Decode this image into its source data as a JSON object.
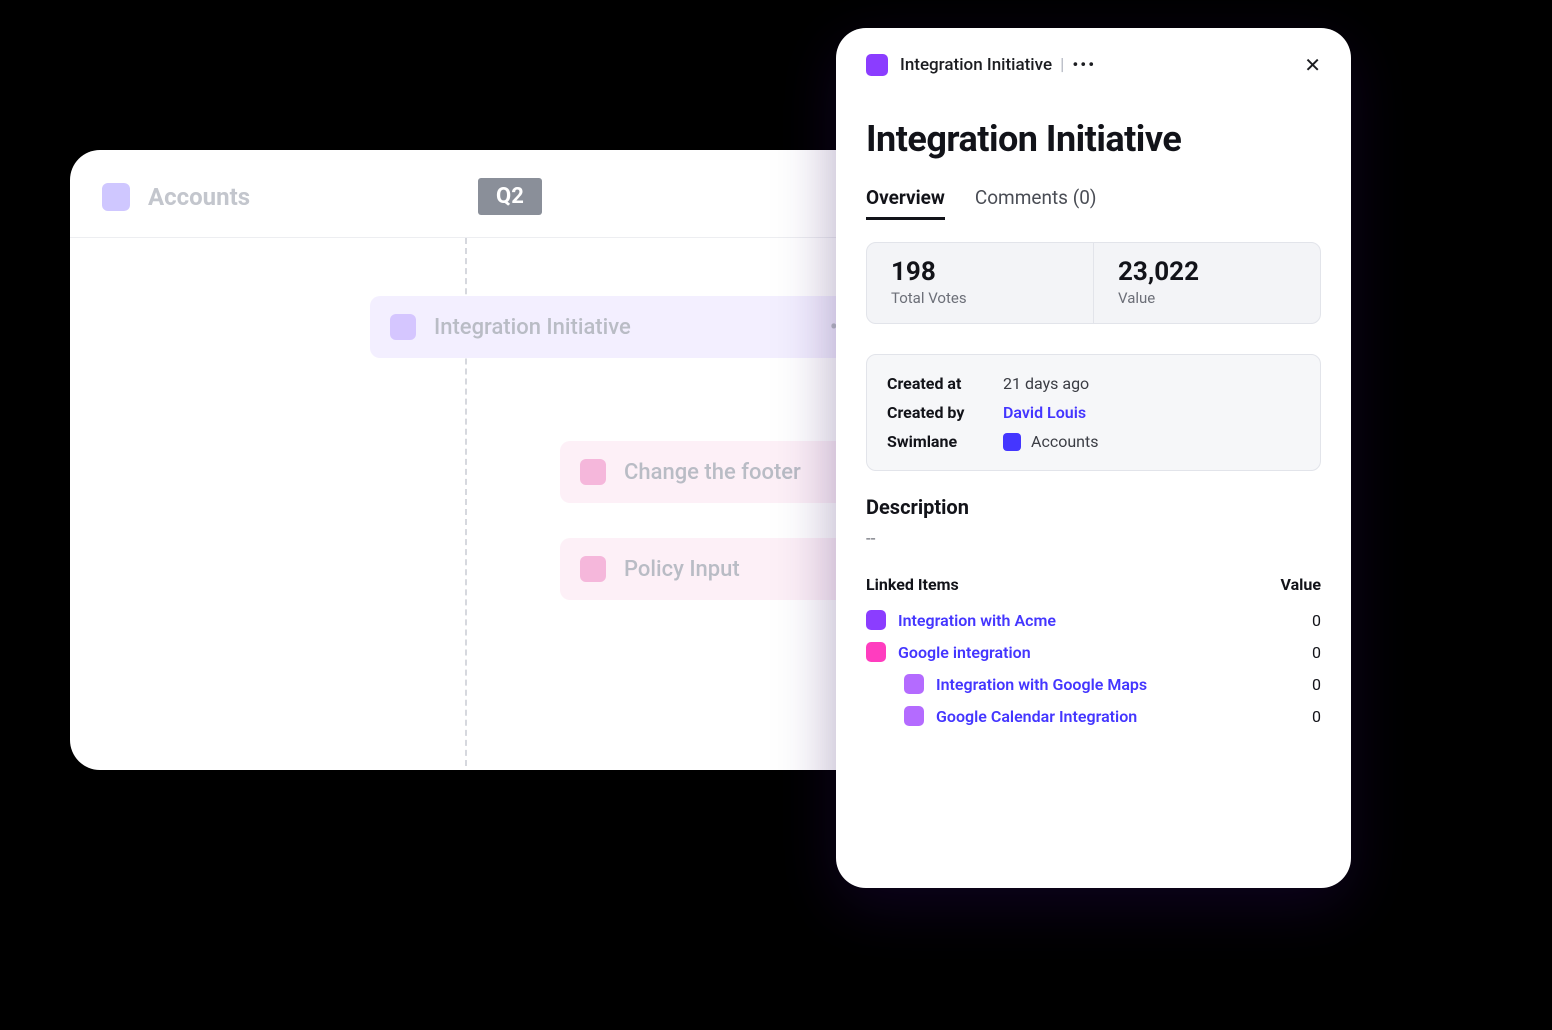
{
  "board": {
    "lane_title": "Accounts",
    "quarter_label": "Q2",
    "bars": [
      {
        "label": "Integration Initiative"
      },
      {
        "label": "Change the footer"
      },
      {
        "label": "Policy Input"
      }
    ]
  },
  "panel": {
    "breadcrumb": "Integration Initiative",
    "title": "Integration Initiative",
    "tabs": {
      "overview": "Overview",
      "comments": "Comments (0)"
    },
    "stats": {
      "votes_value": "198",
      "votes_label": "Total Votes",
      "value_value": "23,022",
      "value_label": "Value"
    },
    "meta": {
      "created_at_key": "Created at",
      "created_at_val": "21 days ago",
      "created_by_key": "Created by",
      "created_by_val": "David Louis",
      "swimlane_key": "Swimlane",
      "swimlane_val": "Accounts"
    },
    "description_head": "Description",
    "description_body": "--",
    "linked_items_head": "Linked Items",
    "linked_value_head": "Value",
    "linked": [
      {
        "name": "Integration with Acme",
        "value": "0",
        "color": "purple",
        "indent": 0
      },
      {
        "name": "Google integration",
        "value": "0",
        "color": "pink",
        "indent": 0
      },
      {
        "name": "Integration with Google Maps",
        "value": "0",
        "color": "violet",
        "indent": 1
      },
      {
        "name": "Google Calendar Integration",
        "value": "0",
        "color": "violet",
        "indent": 1
      }
    ]
  }
}
